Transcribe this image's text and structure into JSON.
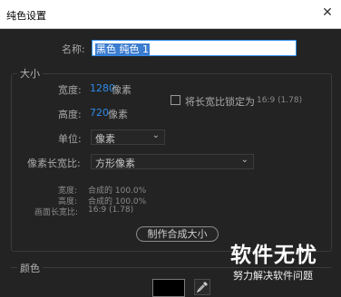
{
  "window": {
    "title": "纯色设置",
    "close_glyph": "✕"
  },
  "name": {
    "label": "名称:",
    "value": "黑色 纯色 1"
  },
  "size_section": {
    "title": "大小",
    "width_label": "宽度:",
    "width_value": "1280",
    "height_label": "高度:",
    "height_value": "720",
    "pixel_unit": "像素",
    "lock_aspect_label": "将长宽比锁定为",
    "lock_aspect_ratio": "16:9 (1.78)",
    "units_label": "单位:",
    "units_value": "像素",
    "pixel_aspect_label": "像素长宽比:",
    "pixel_aspect_value": "方形像素",
    "info_width_label": "宽度:",
    "info_width_value": "合成的 100.0%",
    "info_height_label": "高度:",
    "info_height_value": "合成的 100.0%",
    "info_frame_label": "画面长宽比:",
    "info_frame_value": "16:9 (1.78)",
    "make_comp_size_button": "制作合成大小"
  },
  "color_section": {
    "title": "颜色",
    "swatch_color": "#000000"
  },
  "watermark": {
    "brand": "软件无忧",
    "slogan": "努力解决软件问题"
  },
  "icons": {
    "chevron": "chevron-down-icon",
    "eyedropper": "eyedropper-icon"
  }
}
